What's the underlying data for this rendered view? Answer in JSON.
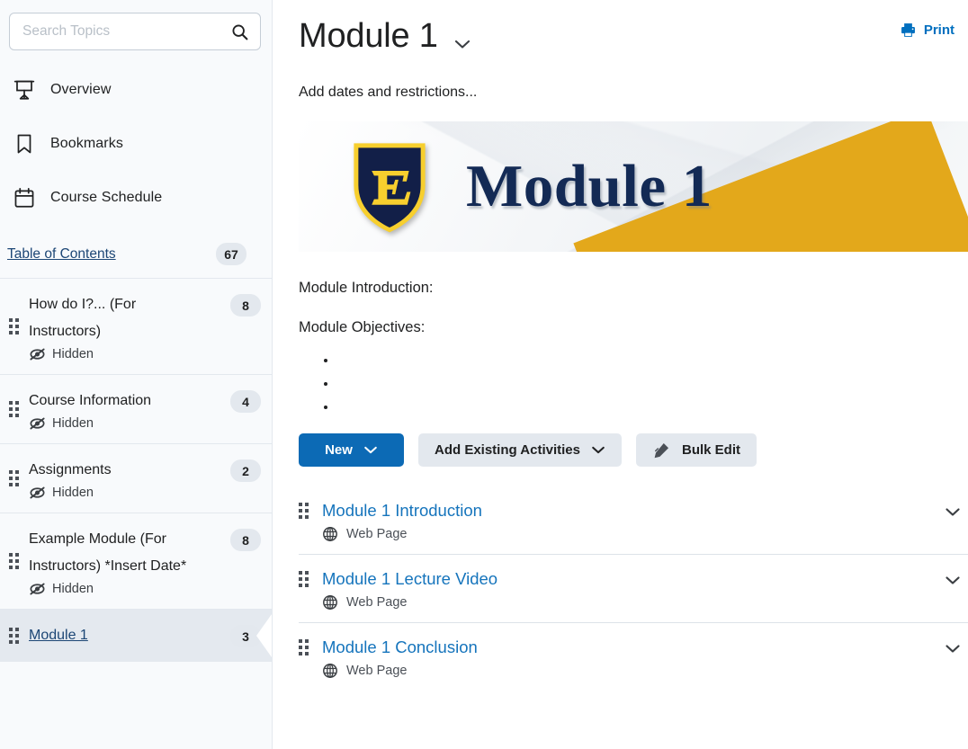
{
  "sidebar": {
    "search": {
      "placeholder": "Search Topics",
      "value": "",
      "button_name": "search"
    },
    "nav": [
      {
        "label": "Overview",
        "icon": "presentation-icon"
      },
      {
        "label": "Bookmarks",
        "icon": "bookmark-icon"
      },
      {
        "label": "Course Schedule",
        "icon": "calendar-icon"
      }
    ],
    "toc": {
      "label": "Table of Contents",
      "count": "67"
    },
    "items": [
      {
        "title": "How do I?... (For Instructors)",
        "count": "8",
        "status": "Hidden",
        "selected": false
      },
      {
        "title": "Course Information",
        "count": "4",
        "status": "Hidden",
        "selected": false
      },
      {
        "title": "Assignments",
        "count": "2",
        "status": "Hidden",
        "selected": false
      },
      {
        "title": "Example Module (For Instructors) *Insert Date*",
        "count": "8",
        "status": "Hidden",
        "selected": false
      },
      {
        "title": "Module 1",
        "count": "3",
        "status": "",
        "selected": true
      }
    ]
  },
  "main": {
    "title": "Module 1",
    "print_label": "Print",
    "dates_link": "Add dates and restrictions...",
    "banner": {
      "text": "Module 1",
      "logo_letter": "E",
      "colors": {
        "shield_navy": "#121f48",
        "shield_gold": "#f7cf2e",
        "text_navy": "#132a55",
        "band_blue": "#2a5da7",
        "band_gold": "#e3a81b"
      }
    },
    "intro_heading": "Module Introduction:",
    "objectives_heading": "Module Objectives:",
    "objectives": [
      "",
      "",
      ""
    ],
    "buttons": [
      {
        "label": "New",
        "style": "primary",
        "caret": true,
        "icon": ""
      },
      {
        "label": "Add Existing Activities",
        "style": "secondary",
        "caret": true,
        "icon": ""
      },
      {
        "label": "Bulk Edit",
        "style": "secondary",
        "caret": false,
        "icon": "pencil-icon"
      }
    ],
    "topics": [
      {
        "title": "Module 1 Introduction",
        "type": "Web Page",
        "icon": "globe-icon"
      },
      {
        "title": "Module 1 Lecture Video",
        "type": "Web Page",
        "icon": "globe-icon"
      },
      {
        "title": "Module 1 Conclusion",
        "type": "Web Page",
        "icon": "globe-icon"
      }
    ]
  },
  "colors": {
    "accent_blue": "#0c6ab5",
    "link_blue": "#1574bc",
    "print_blue": "#006fbf",
    "sidebar_bg": "#f8fafc",
    "selected_bg": "#e4e9ef",
    "badge_bg": "#e3e8ee"
  }
}
